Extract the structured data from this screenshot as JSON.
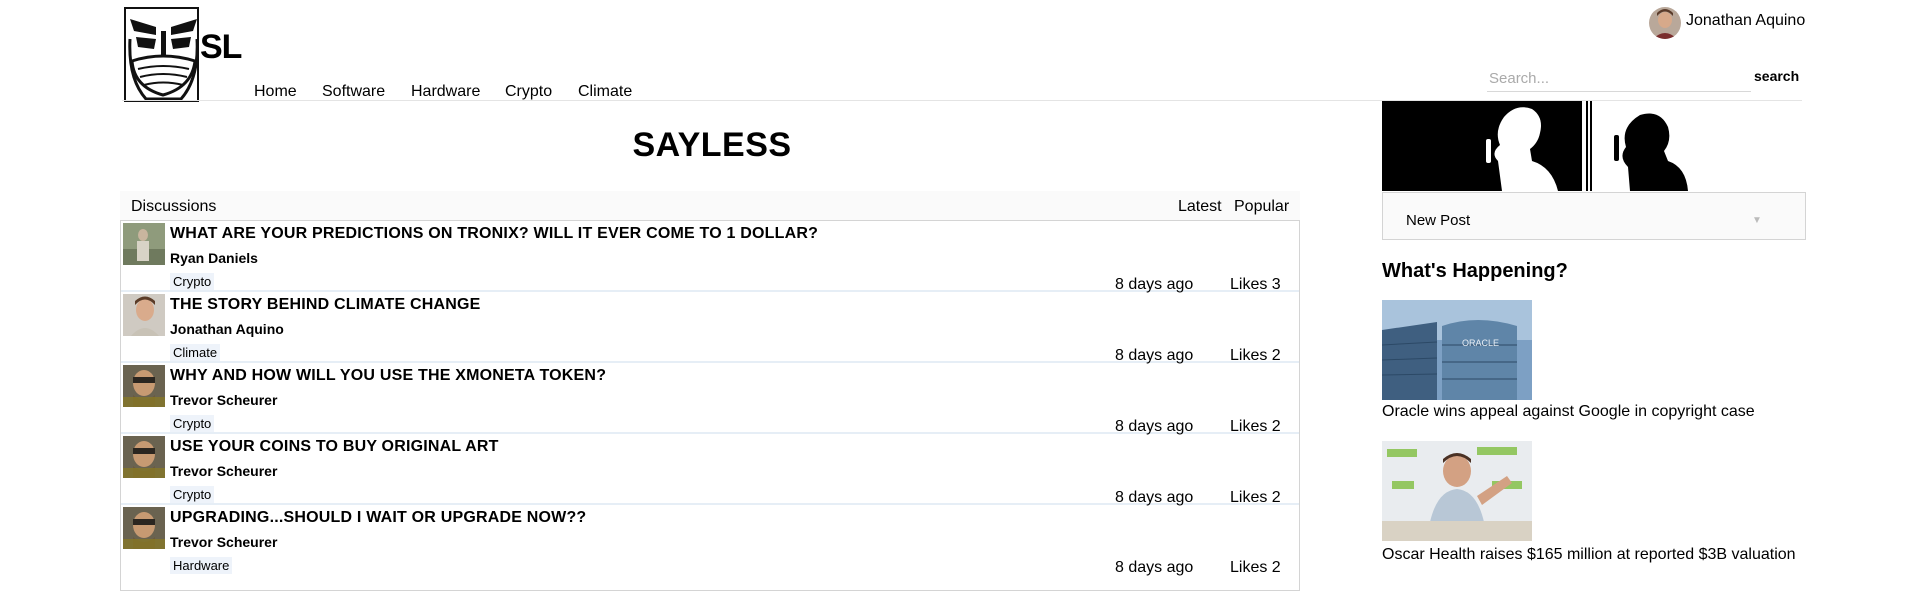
{
  "header": {
    "logo_text": "SL",
    "nav": [
      {
        "label": "Home"
      },
      {
        "label": "Software"
      },
      {
        "label": "Hardware"
      },
      {
        "label": "Crypto"
      },
      {
        "label": "Climate"
      }
    ],
    "user_name": "Jonathan Aquino",
    "search_placeholder": "Search...",
    "search_button": "search"
  },
  "main": {
    "title": "SAYLESS",
    "panel_label": "Discussions",
    "tabs": [
      {
        "label": "Latest"
      },
      {
        "label": "Popular"
      }
    ],
    "posts": [
      {
        "title": "WHAT ARE YOUR PREDICTIONS ON TRONIX? WILL IT EVER COME TO 1 DOLLAR?",
        "author": "Ryan Daniels",
        "tag": "Crypto",
        "time": "8 days ago",
        "likes": "Likes 3"
      },
      {
        "title": "THE STORY BEHIND CLIMATE CHANGE",
        "author": "Jonathan Aquino",
        "tag": "Climate",
        "time": "8 days ago",
        "likes": "Likes 2"
      },
      {
        "title": "WHY AND HOW WILL YOU USE THE XMONETA TOKEN?",
        "author": "Trevor Scheurer",
        "tag": "Crypto",
        "time": "8 days ago",
        "likes": "Likes 2"
      },
      {
        "title": "USE YOUR COINS TO BUY ORIGINAL ART",
        "author": "Trevor Scheurer",
        "tag": "Crypto",
        "time": "8 days ago",
        "likes": "Likes 2"
      },
      {
        "title": "UPGRADING...SHOULD I WAIT OR UPGRADE NOW??",
        "author": "Trevor Scheurer",
        "tag": "Hardware",
        "time": "8 days ago",
        "likes": "Likes 2"
      }
    ]
  },
  "sidebar": {
    "new_post_label": "New Post",
    "happening_title": "What's Happening?",
    "news": [
      {
        "caption": "Oracle wins appeal against Google in copyright case"
      },
      {
        "caption": "Oscar Health raises $165 million at reported $3B valuation"
      }
    ]
  }
}
